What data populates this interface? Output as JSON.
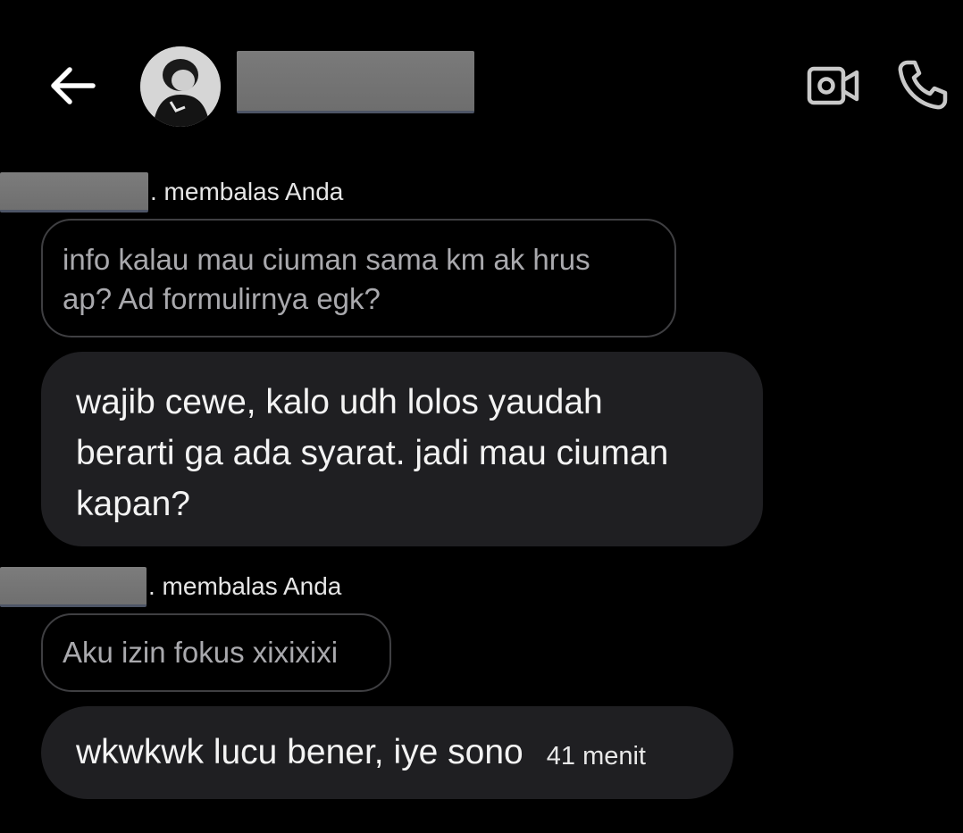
{
  "header": {
    "back_icon": "arrow-left-icon",
    "video_icon": "video-camera-icon",
    "call_icon": "phone-icon"
  },
  "messages": [
    {
      "reply_label": ". membalas Anda",
      "quoted": "info kalau mau ciuman sama km ak hrus ap? Ad formulirnya egk?",
      "quoted_lines": [
        "info kalau mau ciuman sama km ak hrus",
        "ap? Ad formulirnya egk?"
      ],
      "reply_lines": [
        "wajib cewe, kalo udh lolos yaudah",
        "berarti ga ada syarat. jadi mau ciuman",
        "kapan?"
      ]
    },
    {
      "reply_label": ". membalas Anda",
      "quoted": "Aku izin fokus xixixixi",
      "reply": "wkwkwk lucu bener, iye sono",
      "time": "41 menit"
    }
  ],
  "colors": {
    "background": "#000000",
    "bubble": "#1f1f22",
    "quote_border": "#3f3f42",
    "quote_text": "#a9a9ad",
    "redaction": "#767676"
  }
}
